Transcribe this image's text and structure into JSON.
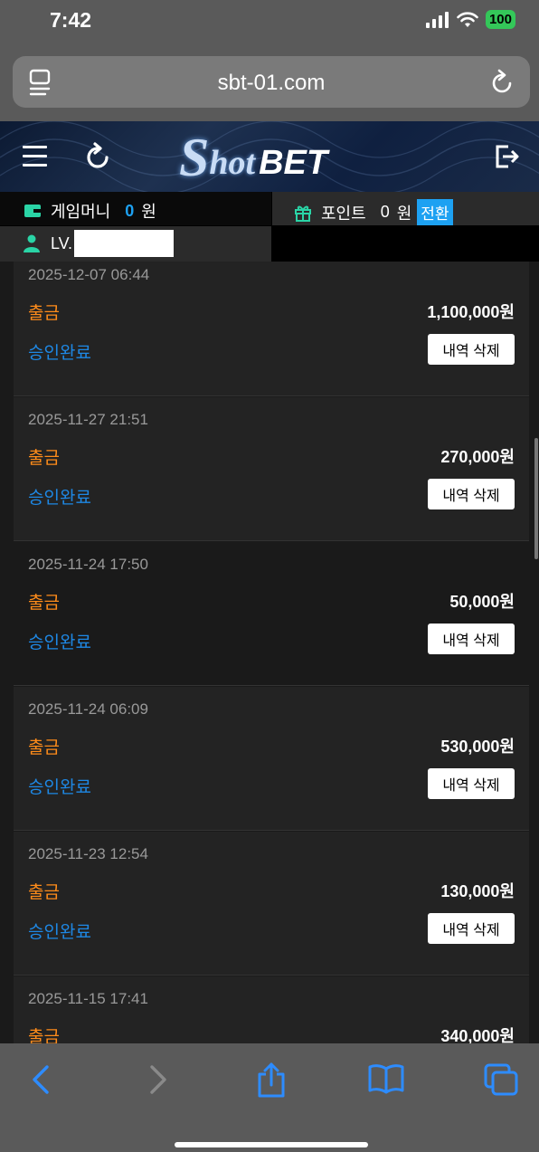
{
  "status_bar": {
    "time": "7:42",
    "battery": "100"
  },
  "browser": {
    "url": "sbt-01.com"
  },
  "site": {
    "logo_s": "S",
    "logo_hot": "hot",
    "logo_bet": "BET"
  },
  "wallet": {
    "money_label": "게임머니",
    "money_value": "0",
    "money_unit": "원",
    "point_label": "포인트",
    "point_value": "0",
    "point_unit": "원",
    "convert_label": "전환",
    "level_label": "LV."
  },
  "entries": [
    {
      "date": "2025-12-07 06:44",
      "type": "출금",
      "amount": "1,100,000원",
      "status": "승인완료",
      "delete_label": "내역 삭제"
    },
    {
      "date": "2025-11-27 21:51",
      "type": "출금",
      "amount": "270,000원",
      "status": "승인완료",
      "delete_label": "내역 삭제"
    },
    {
      "date": "2025-11-24 17:50",
      "type": "출금",
      "amount": "50,000원",
      "status": "승인완료",
      "delete_label": "내역 삭제"
    },
    {
      "date": "2025-11-24 06:09",
      "type": "출금",
      "amount": "530,000원",
      "status": "승인완료",
      "delete_label": "내역 삭제"
    },
    {
      "date": "2025-11-23 12:54",
      "type": "출금",
      "amount": "130,000원",
      "status": "승인완료",
      "delete_label": "내역 삭제"
    },
    {
      "date": "2025-11-15 17:41",
      "type": "출금",
      "amount": "340,000원",
      "status": "",
      "delete_label": ""
    }
  ]
}
